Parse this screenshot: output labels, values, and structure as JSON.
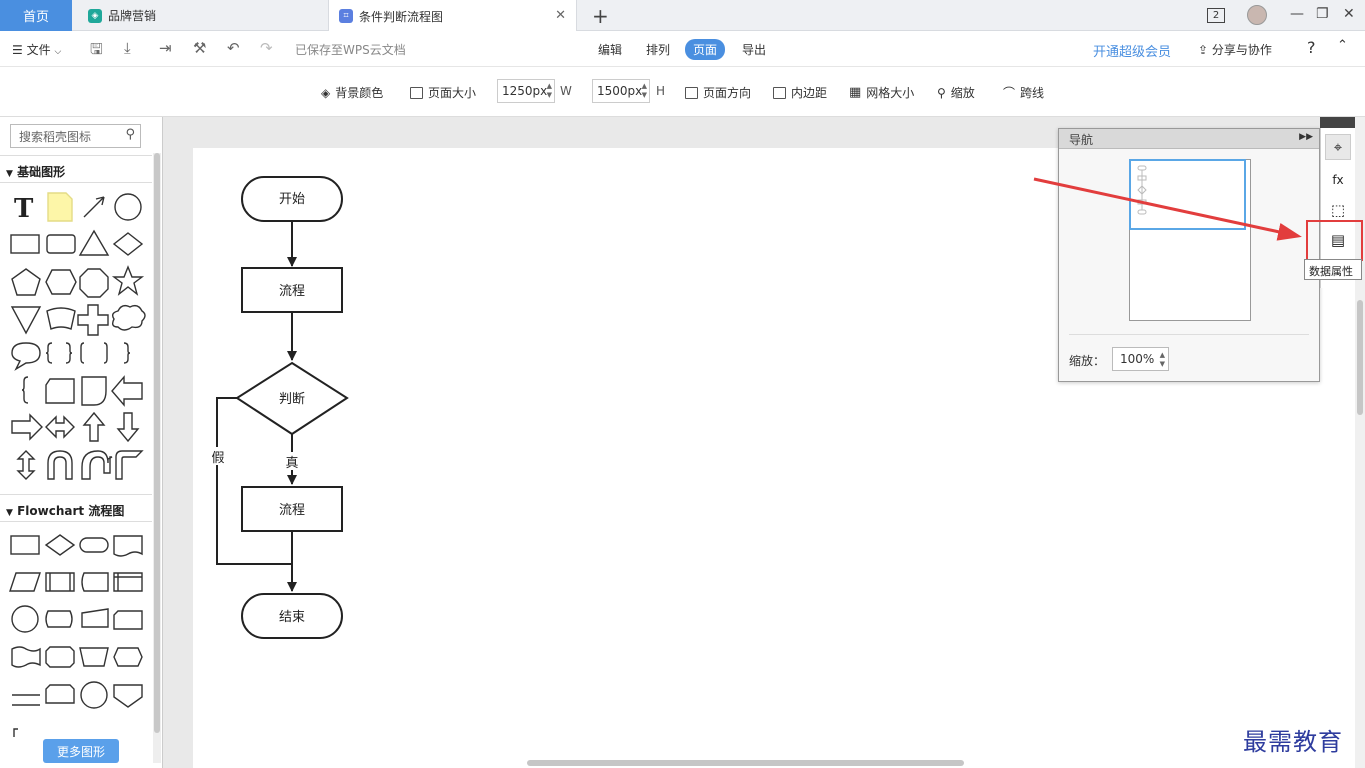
{
  "tabs": {
    "home": "首页",
    "brand": "品牌营销",
    "doc": "条件判断流程图",
    "notifications": "2"
  },
  "menubar": {
    "file": "文件",
    "saved": "已保存至WPS云文档",
    "modes": [
      "编辑",
      "排列",
      "页面",
      "导出"
    ],
    "active_mode": "页面",
    "vip": "开通超级会员",
    "share": "分享与协作",
    "help": "?"
  },
  "toolbar": {
    "bg_color": "背景颜色",
    "page_size": "页面大小",
    "width_value": "1250px",
    "width_unit": "W",
    "height_value": "1500px",
    "height_unit": "H",
    "orientation": "页面方向",
    "padding": "内边距",
    "grid_size": "网格大小",
    "zoom": "缩放",
    "jump": "跨线"
  },
  "sidebar": {
    "search_placeholder": "搜索稻壳图标",
    "basic_section": "基础图形",
    "flowchart_section": "Flowchart 流程图",
    "more_shapes": "更多图形"
  },
  "flowchart": {
    "start": "开始",
    "process1": "流程",
    "decision": "判断",
    "true_label": "真",
    "false_label": "假",
    "process2": "流程",
    "end": "结束"
  },
  "navigator": {
    "title": "导航",
    "zoom_label": "缩放：",
    "zoom_value": "100%"
  },
  "right_tools": {
    "tooltip": "数据属性"
  },
  "watermark": "最需教育",
  "colors": {
    "accent": "#4a8fe0",
    "highlight": "#e23d3d"
  }
}
